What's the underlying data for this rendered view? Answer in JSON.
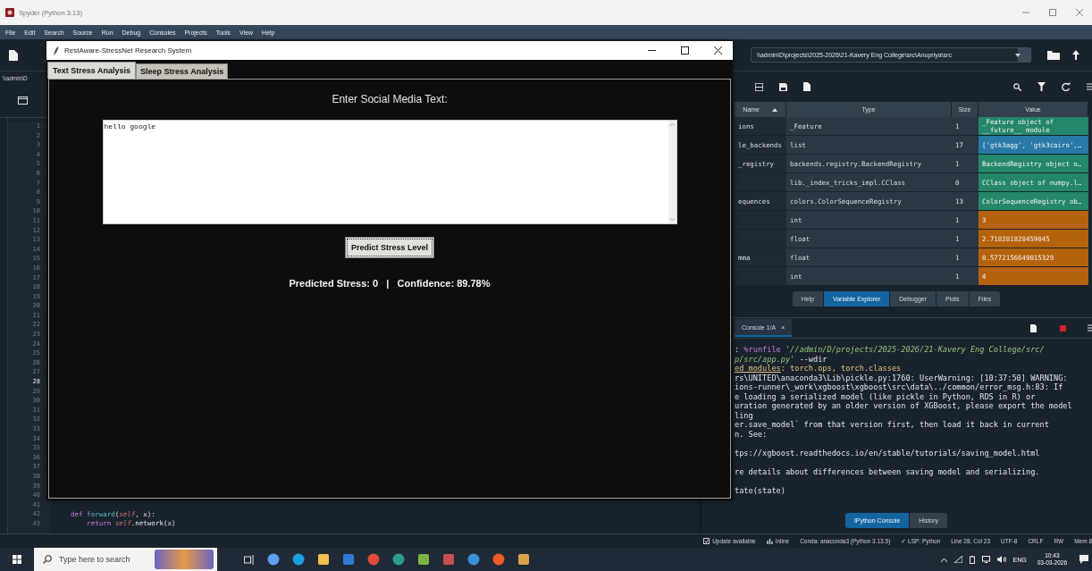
{
  "window": {
    "title": "Spyder (Python 3.13)"
  },
  "menu": [
    "File",
    "Edit",
    "Search",
    "Source",
    "Run",
    "Debug",
    "Consoles",
    "Projects",
    "Tools",
    "View",
    "Help"
  ],
  "toolbar": {
    "path": "\\\\admin\\D\\projects\\2025-2026\\21-Kavery Eng College\\src\\Anupriya\\src"
  },
  "editor": {
    "path": "\\\\admin\\D",
    "line_numbers": [
      {
        "number": "1",
        "current": false
      },
      {
        "number": "2",
        "current": false
      },
      {
        "number": "3",
        "current": false
      },
      {
        "number": "4",
        "current": false
      },
      {
        "number": "5",
        "current": false
      },
      {
        "number": "6",
        "current": false
      },
      {
        "number": "7",
        "current": false
      },
      {
        "number": "8",
        "current": false
      },
      {
        "number": "9",
        "current": false
      },
      {
        "number": "10",
        "current": false
      },
      {
        "number": "11",
        "current": false
      },
      {
        "number": "12",
        "current": false
      },
      {
        "number": "13",
        "current": false
      },
      {
        "number": "14",
        "current": false
      },
      {
        "number": "15",
        "current": false
      },
      {
        "number": "16",
        "current": false
      },
      {
        "number": "17",
        "current": false
      },
      {
        "number": "18",
        "current": false
      },
      {
        "number": "19",
        "current": false
      },
      {
        "number": "20",
        "current": false
      },
      {
        "number": "21",
        "current": false
      },
      {
        "number": "22",
        "current": false
      },
      {
        "number": "23",
        "current": false
      },
      {
        "number": "24",
        "current": false
      },
      {
        "number": "25",
        "current": false
      },
      {
        "number": "26",
        "current": false
      },
      {
        "number": "27",
        "current": false
      },
      {
        "number": "28",
        "current": true
      },
      {
        "number": "29",
        "current": false
      },
      {
        "number": "30",
        "current": false
      },
      {
        "number": "31",
        "current": false
      },
      {
        "number": "32",
        "current": false
      },
      {
        "number": "33",
        "current": false
      },
      {
        "number": "34",
        "current": false
      },
      {
        "number": "35",
        "current": false
      },
      {
        "number": "36",
        "current": false
      },
      {
        "number": "37",
        "current": false
      },
      {
        "number": "38",
        "current": false
      },
      {
        "number": "39",
        "current": false
      },
      {
        "number": "40",
        "current": false
      },
      {
        "number": "41",
        "current": false
      },
      {
        "number": "42",
        "current": false
      },
      {
        "number": "43",
        "current": false
      }
    ],
    "code": [
      {
        "segments": [
          {
            "text": "    def",
            "kind": "keyword"
          },
          {
            "text": " forward",
            "kind": "function"
          },
          {
            "text": "(",
            "kind": "plain"
          },
          {
            "text": "self",
            "kind": "self"
          },
          {
            "text": ", x):",
            "kind": "plain"
          }
        ]
      },
      {
        "segments": [
          {
            "text": "        return ",
            "kind": "keyword"
          },
          {
            "text": "self",
            "kind": "self"
          },
          {
            "text": ".network(x)",
            "kind": "plain"
          }
        ]
      }
    ]
  },
  "variable_explorer": {
    "columns": [
      "Name",
      "Type",
      "Size",
      "Value"
    ],
    "rows": [
      {
        "name": "ions",
        "type": "_Feature",
        "size": "1",
        "value": "_Feature object of __future__ module",
        "color": "#24866a"
      },
      {
        "name": "le_backends",
        "type": "list",
        "size": "17",
        "value": "['gtk3agg', 'gtk3cairo',…",
        "color": "#2878a8"
      },
      {
        "name": "_registry",
        "type": "backends.registry.BackendRegistry",
        "size": "1",
        "value": "BackendRegistry object o…",
        "color": "#24866a"
      },
      {
        "type": "lib._index_tricks_impl.CClass",
        "size": "0",
        "value": "CClass object of numpy.l…",
        "color": "#24866a"
      },
      {
        "name": "equences",
        "type": "colors.ColorSequenceRegistry",
        "size": "13",
        "value": "ColorSequenceRegistry ob…",
        "color": "#24866a"
      },
      {
        "type": "int",
        "size": "1",
        "value": "3",
        "color": "#b5620c"
      },
      {
        "type": "float",
        "size": "1",
        "value": "2.718281828459045",
        "color": "#b5620c"
      },
      {
        "name": "mma",
        "type": "float",
        "size": "1",
        "value": "0.5772156649015329",
        "color": "#b5620c"
      },
      {
        "type": "int",
        "size": "1",
        "value": "4",
        "color": "#b5620c"
      }
    ],
    "tabs": [
      {
        "label": "Help",
        "selected": false
      },
      {
        "label": "Variable Explorer",
        "selected": true
      },
      {
        "label": "Debugger",
        "selected": false
      },
      {
        "label": "Plots",
        "selected": false
      },
      {
        "label": "Files",
        "selected": false
      }
    ]
  },
  "console": {
    "tab": "Console 1/A",
    "close_glyph": "×",
    "blocks": [
      {
        "lines": [
          {
            "segments": [
              {
                "text": ": ",
                "kind": "plain"
              },
              {
                "text": "%runfile",
                "kind": "magic"
              },
              {
                "text": " '//admin/D/projects/2025-2026/21-Kavery Eng College/src/",
                "kind": "string"
              }
            ]
          },
          {
            "segments": [
              {
                "text": "p/src/app.py'",
                "kind": "string"
              },
              {
                "text": " --wdir",
                "kind": "plain"
              }
            ]
          },
          {
            "segments": [
              {
                "text": "ed modules",
                "kind": "link"
              },
              {
                "text": ": torch.ops, torch.classes",
                "kind": "warn"
              }
            ]
          },
          {
            "segments": [
              {
                "text": "rs\\UNITED\\anaconda3\\Lib\\pickle.py:1760: UserWarning: [10:37:50] WARNING:",
                "kind": "plain"
              }
            ]
          },
          {
            "segments": [
              {
                "text": "ions-runner\\_work\\xgboost\\xgboost\\src\\data\\../common/error_msg.h:83: If",
                "kind": "plain"
              }
            ]
          },
          {
            "segments": [
              {
                "text": "e loading a serialized model (like pickle in Python, RDS in R) or",
                "kind": "plain"
              }
            ]
          },
          {
            "segments": [
              {
                "text": "uration generated by an older version of XGBoost, please export the model",
                "kind": "plain"
              }
            ]
          },
          {
            "segments": [
              {
                "text": "ling",
                "kind": "plain"
              }
            ]
          },
          {
            "segments": [
              {
                "text": "er.save_model` from that version first, then load it back in current",
                "kind": "plain"
              }
            ]
          },
          {
            "segments": [
              {
                "text": "n. See:",
                "kind": "plain"
              }
            ]
          }
        ]
      },
      {
        "lines": [
          {
            "segments": [
              {
                "text": "tps://xgboost.readthedocs.io/en/stable/tutorials/saving_model.html",
                "kind": "plain"
              }
            ]
          }
        ]
      },
      {
        "lines": [
          {
            "segments": [
              {
                "text": "re details about differences between saving model and serializing.",
                "kind": "plain"
              }
            ]
          }
        ]
      },
      {
        "lines": [
          {
            "segments": [
              {
                "text": "tate(state)",
                "kind": "plain"
              }
            ]
          }
        ]
      }
    ],
    "tabs": [
      {
        "label": "IPython Console",
        "selected": true
      },
      {
        "label": "History",
        "selected": false
      }
    ]
  },
  "status_bar": [
    {
      "text": "Update available",
      "kind": "update"
    },
    {
      "text": "Inline",
      "kind": "chart"
    },
    {
      "text": "Conda: anaconda3 (Python 3.13.5)",
      "kind": "text"
    },
    {
      "text": "✓ LSP: Python",
      "kind": "text"
    },
    {
      "text": "Line 28, Col 23",
      "kind": "text"
    },
    {
      "text": "UTF-8",
      "kind": "text"
    },
    {
      "text": "CRLF",
      "kind": "text"
    },
    {
      "text": "RW",
      "kind": "text"
    },
    {
      "text": "Mem 8",
      "kind": "text"
    }
  ],
  "dialog": {
    "title": "RestAware-StressNet Research System",
    "tabs": [
      {
        "label": "Text Stress Analysis",
        "selected": true
      },
      {
        "label": "Sleep Stress Analysis",
        "selected": false
      }
    ],
    "prompt": "Enter Social Media Text:",
    "text_value": "hello google",
    "button": "Predict Stress Level",
    "result": "Predicted Stress: 0   |   Confidence: 89.78%"
  },
  "taskbar": {
    "search_placeholder": "Type here to search",
    "language": "ENG",
    "time": "10:43",
    "date": "03-03-2026"
  }
}
